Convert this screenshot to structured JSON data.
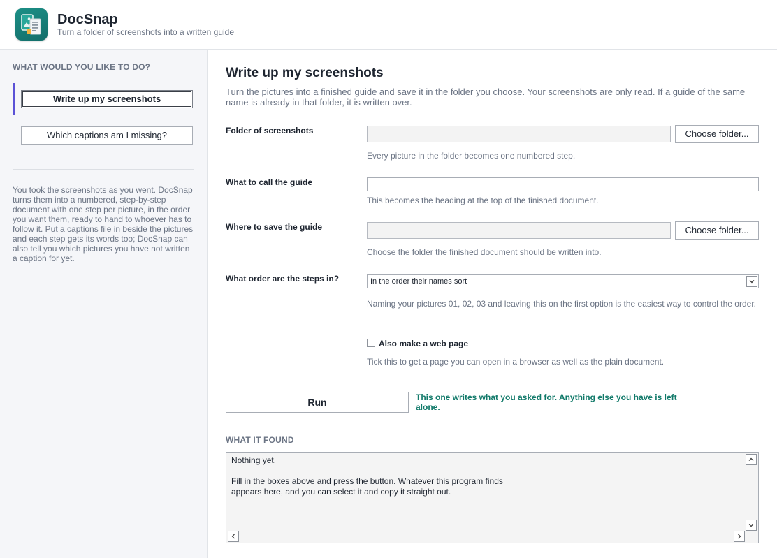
{
  "app": {
    "title": "DocSnap",
    "subtitle": "Turn a folder of screenshots into a written guide",
    "icon": "docsnap-app-icon",
    "accent": "#5b52d6",
    "note_color": "#127a6a"
  },
  "sidebar": {
    "heading": "WHAT WOULD YOU LIKE TO DO?",
    "items": [
      {
        "label": "Write up my screenshots",
        "active": true
      },
      {
        "label": "Which captions am I missing?",
        "active": false
      }
    ],
    "description": "You took the screenshots as you went. DocSnap turns them into a numbered, step-by-step document with one step per picture, in the order you want them, ready to hand to whoever has to follow it. Put a captions file in beside the pictures and each step gets its words too; DocSnap can also tell you which pictures you have not written a caption for yet."
  },
  "main": {
    "title": "Write up my screenshots",
    "description": "Turn the pictures into a finished guide and save it in the folder you choose. Your screenshots are only read. If a guide of the same name is already in that folder, it is written over.",
    "fields": {
      "screenshots_folder": {
        "label": "Folder of screenshots",
        "value": "",
        "button": "Choose folder...",
        "hint": "Every picture in the folder becomes one numbered step."
      },
      "guide_name": {
        "label": "What to call the guide",
        "value": "",
        "hint": "This becomes the heading at the top of the finished document."
      },
      "save_folder": {
        "label": "Where to save the guide",
        "value": "",
        "button": "Choose folder...",
        "hint": "Choose the folder the finished document should be written into."
      },
      "step_order": {
        "label": "What order are the steps in?",
        "selected": "In the order their names sort",
        "hint": "Naming your pictures 01, 02, 03 and leaving this on the first option is the easiest way to control the order."
      },
      "web_page": {
        "label": "Also make a web page",
        "checked": false,
        "hint": "Tick this to get a page you can open in a browser as well as the plain document."
      }
    },
    "run": {
      "label": "Run",
      "note": "This one writes what you asked for. Anything else you have is left alone."
    },
    "output": {
      "heading": "WHAT IT FOUND",
      "text": "Nothing yet.\n\nFill in the boxes above and press the button. Whatever this program finds\nappears here, and you can select it and copy it straight out."
    }
  }
}
